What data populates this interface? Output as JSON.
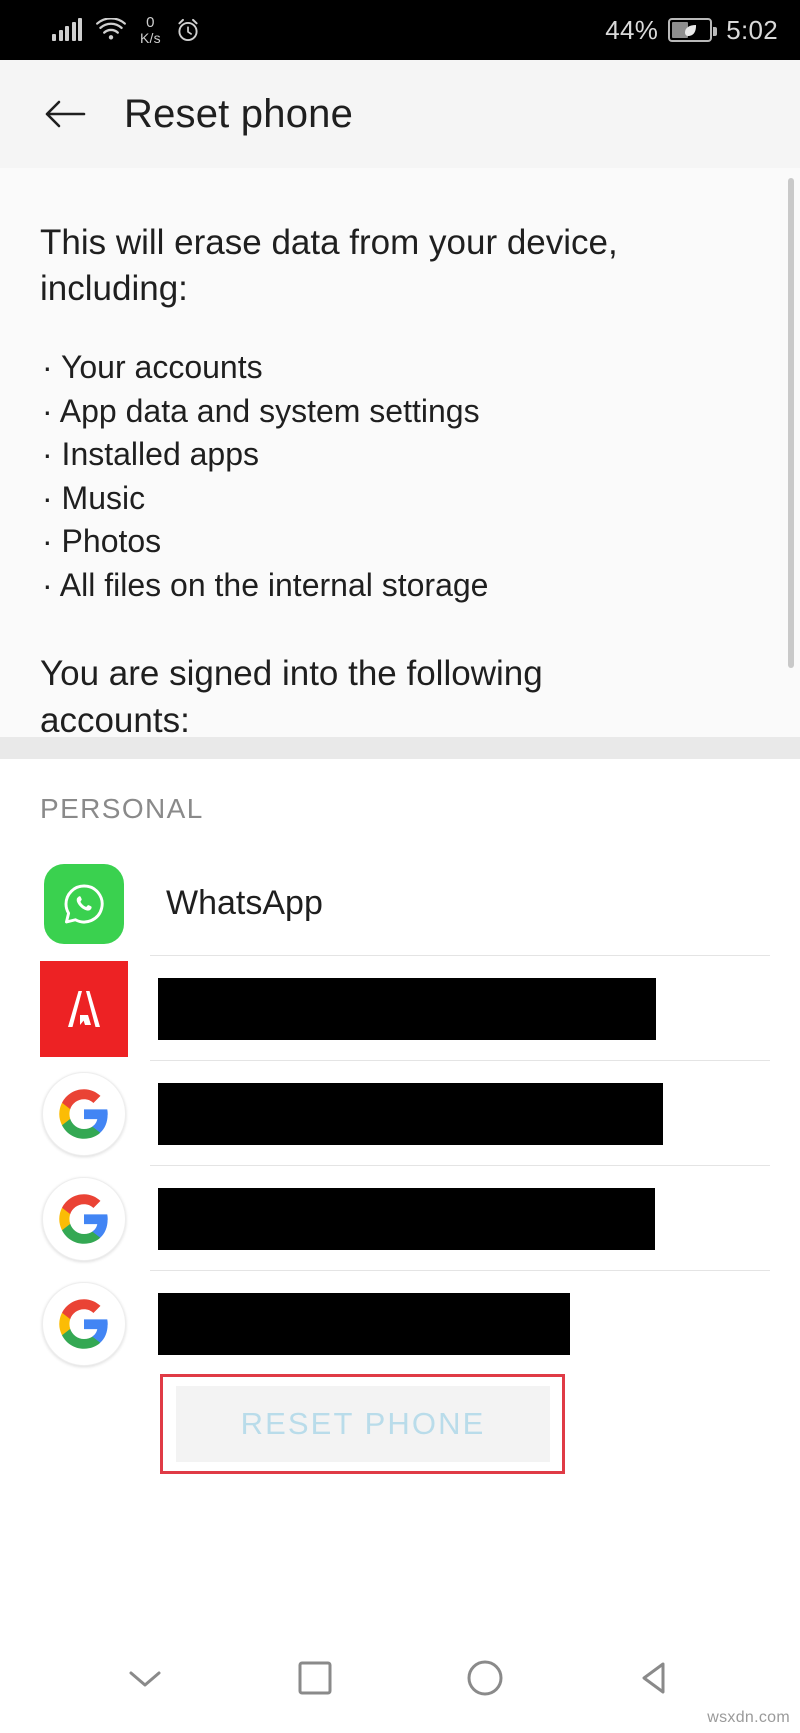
{
  "status_bar": {
    "network_speed_value": "0",
    "network_speed_unit": "K/s",
    "battery_percent": "44%",
    "time": "5:02",
    "icons": [
      "signal-bars-icon",
      "wifi-icon",
      "alarm-clock-icon",
      "battery-saver-icon"
    ]
  },
  "app_bar": {
    "back_label": "back-arrow",
    "title": "Reset phone"
  },
  "description": {
    "intro": "This will erase data from your device, including:",
    "items": [
      "Your accounts",
      "App data and system settings",
      "Installed apps",
      "Music",
      "Photos",
      "All files on the internal storage"
    ],
    "outro": "You are signed into the following accounts:"
  },
  "accounts": {
    "section_label": "PERSONAL",
    "rows": [
      {
        "icon": "whatsapp-icon",
        "name": "WhatsApp",
        "redacted": false
      },
      {
        "icon": "adobe-icon",
        "name": "",
        "redacted": true
      },
      {
        "icon": "google-icon",
        "name": "",
        "redacted": true
      },
      {
        "icon": "google-icon",
        "name": "",
        "redacted": true
      },
      {
        "icon": "google-icon",
        "name": "",
        "redacted": true
      }
    ]
  },
  "reset_button": {
    "label": "RESET PHONE",
    "text_color": "#b9dcea",
    "background": "#f3f3f3",
    "disabled": true
  },
  "annotation": {
    "color": "#e03b46",
    "target": "reset-phone-button"
  },
  "nav_bar": {
    "items": [
      "chevron-down-icon",
      "square-icon",
      "circle-icon",
      "triangle-back-icon"
    ]
  },
  "watermark": {
    "text": "wsxdn.com"
  },
  "colors": {
    "status_bar_bg": "#000000",
    "app_bar_bg": "#f5f5f5",
    "whatsapp_green": "#3ad14f",
    "adobe_red": "#ed2224",
    "google_blue": "#4285f4",
    "google_red": "#ea4335",
    "google_yellow": "#fbbc05",
    "google_green": "#34a853",
    "redaction": "#000000",
    "annotation_red": "#e03b46"
  }
}
